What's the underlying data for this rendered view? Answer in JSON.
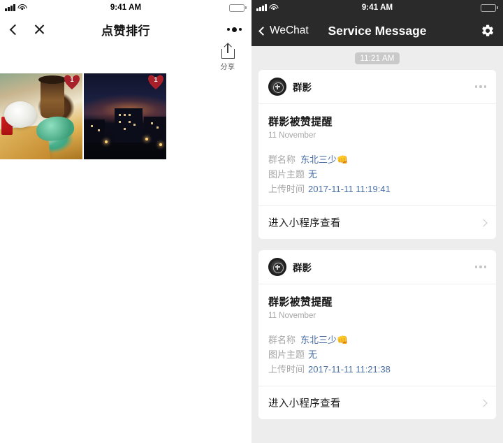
{
  "left_panel": {
    "status_bar": {
      "time": "9:41 AM",
      "signal_icon": "signal-bars-icon",
      "wifi_icon": "wifi-icon",
      "battery_icon": "battery-icon"
    },
    "nav": {
      "back_icon": "back-chevron-icon",
      "close_icon": "close-x-icon",
      "title": "点赞排行",
      "more_icon": "more-dots-icon"
    },
    "share": {
      "icon": "share-upload-icon",
      "label": "分享"
    },
    "photos": [
      {
        "name": "photo-food",
        "like_count": "1",
        "badge_icon": "heart-badge-icon"
      },
      {
        "name": "photo-night-city",
        "like_count": "1",
        "badge_icon": "heart-badge-icon"
      }
    ]
  },
  "right_panel": {
    "status_bar": {
      "time": "9:41 AM",
      "signal_icon": "signal-bars-icon",
      "wifi_icon": "wifi-icon",
      "battery_icon": "battery-icon"
    },
    "nav": {
      "back_label": "WeChat",
      "back_icon": "back-chevron-icon",
      "title": "Service Message",
      "settings_icon": "gear-icon"
    },
    "conversation_timestamp": "11:21 AM",
    "messages": [
      {
        "account_name": "群影",
        "avatar_icon": "camera-lens-avatar-icon",
        "more_icon": "more-dots-icon",
        "title": "群影被赞提醒",
        "date": "11 November",
        "details": [
          {
            "label": "群名称",
            "value": "东北三少",
            "emoji": "👊"
          },
          {
            "label": "图片主题",
            "value": "无",
            "emoji": ""
          },
          {
            "label": "上传时间",
            "value": "2017-11-11 11:19:41",
            "emoji": ""
          }
        ],
        "action_label": "进入小程序查看",
        "action_icon": "chevron-right-icon"
      },
      {
        "account_name": "群影",
        "avatar_icon": "camera-lens-avatar-icon",
        "more_icon": "more-dots-icon",
        "title": "群影被赞提醒",
        "date": "11 November",
        "details": [
          {
            "label": "群名称",
            "value": "东北三少",
            "emoji": "👊"
          },
          {
            "label": "图片主题",
            "value": "无",
            "emoji": ""
          },
          {
            "label": "上传时间",
            "value": "2017-11-11 11:21:38",
            "emoji": ""
          }
        ],
        "action_label": "进入小程序查看",
        "action_icon": "chevron-right-icon"
      }
    ]
  },
  "colors": {
    "nav_bar_dark": "#2a2a2a",
    "chat_background": "#ededed",
    "card_background": "#ffffff",
    "detail_value_blue": "#4a6fa5",
    "muted_gray": "#a6a6a6",
    "heart_badge_red": "#a8202a"
  }
}
